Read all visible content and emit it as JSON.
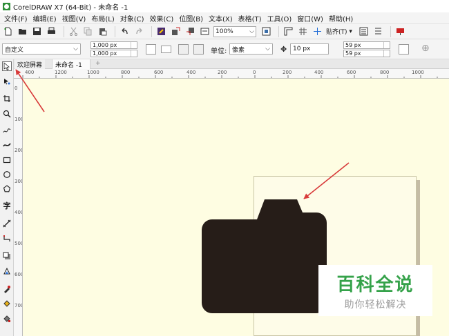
{
  "window": {
    "title": "CorelDRAW X7 (64-Bit) - 未命名 -1"
  },
  "menubar": {
    "items": [
      "文件(F)",
      "编辑(E)",
      "视图(V)",
      "布局(L)",
      "对象(C)",
      "效果(C)",
      "位图(B)",
      "文本(X)",
      "表格(T)",
      "工具(O)",
      "窗口(W)",
      "帮助(H)"
    ]
  },
  "toolbar": {
    "zoom_value": "100%",
    "snap_label": "贴齐(T)"
  },
  "propbar": {
    "preset_value": "自定义",
    "width_value": "1,000 px",
    "height_value": "1,000 px",
    "units_label": "单位:",
    "units_value": "像素",
    "nudge_value": "10 px",
    "dup_x_value": "59 px",
    "dup_y_value": "59 px"
  },
  "tabs": {
    "welcome": "欢迎屏幕",
    "document": "未命名 -1",
    "add": "+"
  },
  "ruler": {
    "h_labels": [
      "400",
      "1200",
      "1000",
      "800",
      "600",
      "400",
      "200",
      "0",
      "200",
      "400",
      "600",
      "800",
      "1000"
    ],
    "v_labels": [
      "0",
      "100",
      "200",
      "300",
      "400",
      "500",
      "600",
      "700"
    ]
  },
  "colors": {
    "canvas": "#fefde2",
    "shape": "#261d18",
    "arrow": "#d83a3a",
    "watermark": "#35a24a"
  },
  "watermark": {
    "title": "百科全说",
    "subtitle": "助你轻松解决"
  },
  "icons": [
    "pick-tool-icon",
    "shape-tool-icon",
    "crop-tool-icon",
    "zoom-tool-icon",
    "freehand-tool-icon",
    "artistic-media-icon",
    "rectangle-tool-icon",
    "ellipse-tool-icon",
    "polygon-tool-icon",
    "text-tool-icon",
    "parallel-dimension-icon",
    "connector-tool-icon",
    "drop-shadow-icon",
    "transparency-icon",
    "eyedropper-icon",
    "fill-tool-icon",
    "smart-fill-icon"
  ]
}
